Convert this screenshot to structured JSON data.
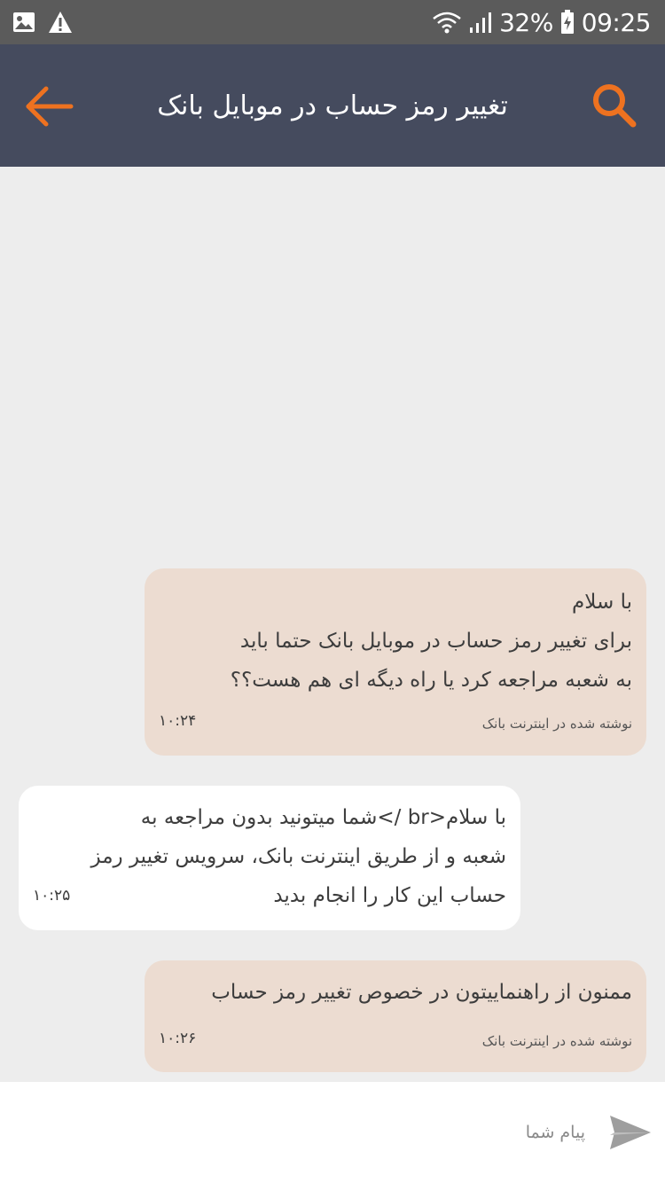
{
  "status_bar": {
    "battery": "32%",
    "time": "09:25",
    "icons": [
      "image-icon",
      "warning-icon",
      "wifi-icon",
      "signal-icon",
      "battery-charging-icon"
    ]
  },
  "header": {
    "title": "تغییر رمز حساب در موبایل بانک",
    "back_icon": "arrow-left-icon",
    "search_icon": "search-icon",
    "accent_color": "#ee7220",
    "background_color": "#454b5e"
  },
  "messages": [
    {
      "direction": "sent",
      "text": "با سلام\nبرای تغییر رمز حساب در موبایل بانک حتما باید\nبه شعبه مراجعه کرد یا راه دیگه ای هم هست؟؟",
      "note": "نوشته شده در اینترنت بانک",
      "time": "۱۰:۲۴"
    },
    {
      "direction": "received",
      "text": "با سلام<br />شما میتونید بدون مراجعه به\nشعبه و از طریق اینترنت بانک، سرویس تغییر رمز\nحساب این کار را انجام بدید",
      "time": "۱۰:۲۵"
    },
    {
      "direction": "sent",
      "text": "ممنون از راهنماییتون در خصوص تغییر رمز حساب",
      "note": "نوشته شده در اینترنت بانک",
      "time": "۱۰:۲۶"
    }
  ],
  "composer": {
    "placeholder": "پیام شما",
    "send_icon": "send-icon"
  },
  "colors": {
    "sent_bubble": "#ecdcd1",
    "received_bubble": "#ffffff",
    "chat_background": "#ededed"
  }
}
